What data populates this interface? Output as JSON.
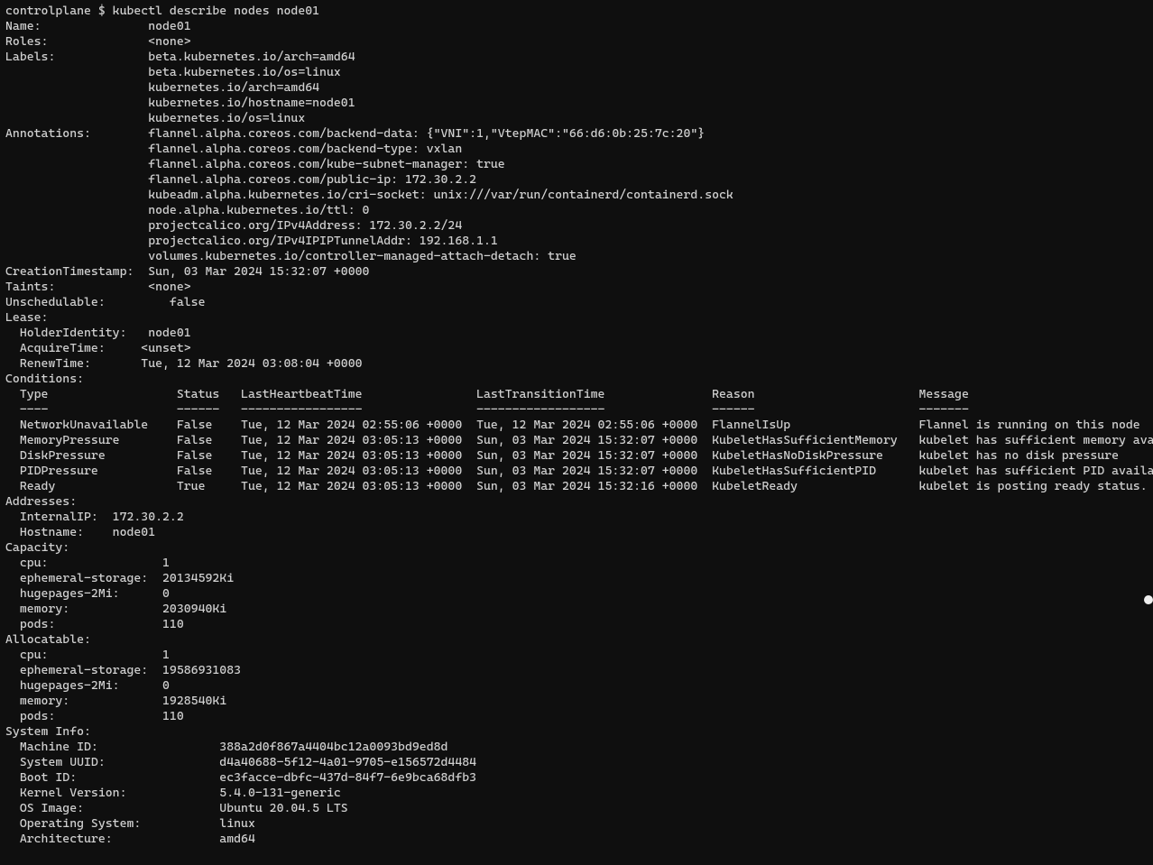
{
  "prompt": {
    "host": "controlplane",
    "sep": "$",
    "cmd": "kubectl describe nodes node01"
  },
  "name": {
    "k": "Name:",
    "v": "node01"
  },
  "roles": {
    "k": "Roles:",
    "v": "<none>"
  },
  "labels": {
    "k": "Labels:",
    "items": [
      "beta.kubernetes.io/arch=amd64",
      "beta.kubernetes.io/os=linux",
      "kubernetes.io/arch=amd64",
      "kubernetes.io/hostname=node01",
      "kubernetes.io/os=linux"
    ]
  },
  "annotations": {
    "k": "Annotations:",
    "items": [
      "flannel.alpha.coreos.com/backend-data: {\"VNI\":1,\"VtepMAC\":\"66:d6:0b:25:7c:20\"}",
      "flannel.alpha.coreos.com/backend-type: vxlan",
      "flannel.alpha.coreos.com/kube-subnet-manager: true",
      "flannel.alpha.coreos.com/public-ip: 172.30.2.2",
      "kubeadm.alpha.kubernetes.io/cri-socket: unix:///var/run/containerd/containerd.sock",
      "node.alpha.kubernetes.io/ttl: 0",
      "projectcalico.org/IPv4Address: 172.30.2.2/24",
      "projectcalico.org/IPv4IPIPTunnelAddr: 192.168.1.1",
      "volumes.kubernetes.io/controller-managed-attach-detach: true"
    ]
  },
  "creation": {
    "k": "CreationTimestamp:",
    "v": "Sun, 03 Mar 2024 15:32:07 +0000"
  },
  "taints": {
    "k": "Taints:",
    "v": "<none>"
  },
  "unsched": {
    "k": "Unschedulable:",
    "v": "false"
  },
  "lease": {
    "hdr": "Lease:",
    "holder": {
      "k": "HolderIdentity:",
      "v": "node01"
    },
    "acquire": {
      "k": "AcquireTime:",
      "v": "<unset>"
    },
    "renew": {
      "k": "RenewTime:",
      "v": "Tue, 12 Mar 2024 03:08:04 +0000"
    }
  },
  "conditions": {
    "hdr": "Conditions:",
    "cols": [
      "Type",
      "Status",
      "LastHeartbeatTime",
      "LastTransitionTime",
      "Reason",
      "Message"
    ],
    "dash": [
      "----",
      "------",
      "-----------------",
      "------------------",
      "------",
      "-------"
    ],
    "rows": [
      [
        "NetworkUnavailable",
        "False",
        "Tue, 12 Mar 2024 02:55:06 +0000",
        "Tue, 12 Mar 2024 02:55:06 +0000",
        "FlannelIsUp",
        "Flannel is running on this node"
      ],
      [
        "MemoryPressure",
        "False",
        "Tue, 12 Mar 2024 03:05:13 +0000",
        "Sun, 03 Mar 2024 15:32:07 +0000",
        "KubeletHasSufficientMemory",
        "kubelet has sufficient memory available"
      ],
      [
        "DiskPressure",
        "False",
        "Tue, 12 Mar 2024 03:05:13 +0000",
        "Sun, 03 Mar 2024 15:32:07 +0000",
        "KubeletHasNoDiskPressure",
        "kubelet has no disk pressure"
      ],
      [
        "PIDPressure",
        "False",
        "Tue, 12 Mar 2024 03:05:13 +0000",
        "Sun, 03 Mar 2024 15:32:07 +0000",
        "KubeletHasSufficientPID",
        "kubelet has sufficient PID available"
      ],
      [
        "Ready",
        "True",
        "Tue, 12 Mar 2024 03:05:13 +0000",
        "Sun, 03 Mar 2024 15:32:16 +0000",
        "KubeletReady",
        "kubelet is posting ready status. AppArmor enabled"
      ]
    ]
  },
  "addresses": {
    "hdr": "Addresses:",
    "rows": [
      {
        "k": "InternalIP:",
        "v": "172.30.2.2"
      },
      {
        "k": "Hostname:",
        "v": "node01"
      }
    ]
  },
  "capacity": {
    "hdr": "Capacity:",
    "rows": [
      {
        "k": "cpu:",
        "v": "1"
      },
      {
        "k": "ephemeral-storage:",
        "v": "20134592Ki"
      },
      {
        "k": "hugepages-2Mi:",
        "v": "0"
      },
      {
        "k": "memory:",
        "v": "2030940Ki"
      },
      {
        "k": "pods:",
        "v": "110"
      }
    ]
  },
  "allocatable": {
    "hdr": "Allocatable:",
    "rows": [
      {
        "k": "cpu:",
        "v": "1"
      },
      {
        "k": "ephemeral-storage:",
        "v": "19586931083"
      },
      {
        "k": "hugepages-2Mi:",
        "v": "0"
      },
      {
        "k": "memory:",
        "v": "1928540Ki"
      },
      {
        "k": "pods:",
        "v": "110"
      }
    ]
  },
  "sysinfo": {
    "hdr": "System Info:",
    "rows": [
      {
        "k": "Machine ID:",
        "v": "388a2d0f867a4404bc12a0093bd9ed8d"
      },
      {
        "k": "System UUID:",
        "v": "d4a40688-5f12-4a01-9705-e156572d4484"
      },
      {
        "k": "Boot ID:",
        "v": "ec3facce-dbfc-437d-84f7-6e9bca68dfb3"
      },
      {
        "k": "Kernel Version:",
        "v": "5.4.0-131-generic"
      },
      {
        "k": "OS Image:",
        "v": "Ubuntu 20.04.5 LTS"
      },
      {
        "k": "Operating System:",
        "v": "linux"
      },
      {
        "k": "Architecture:",
        "v": "amd64"
      }
    ]
  }
}
